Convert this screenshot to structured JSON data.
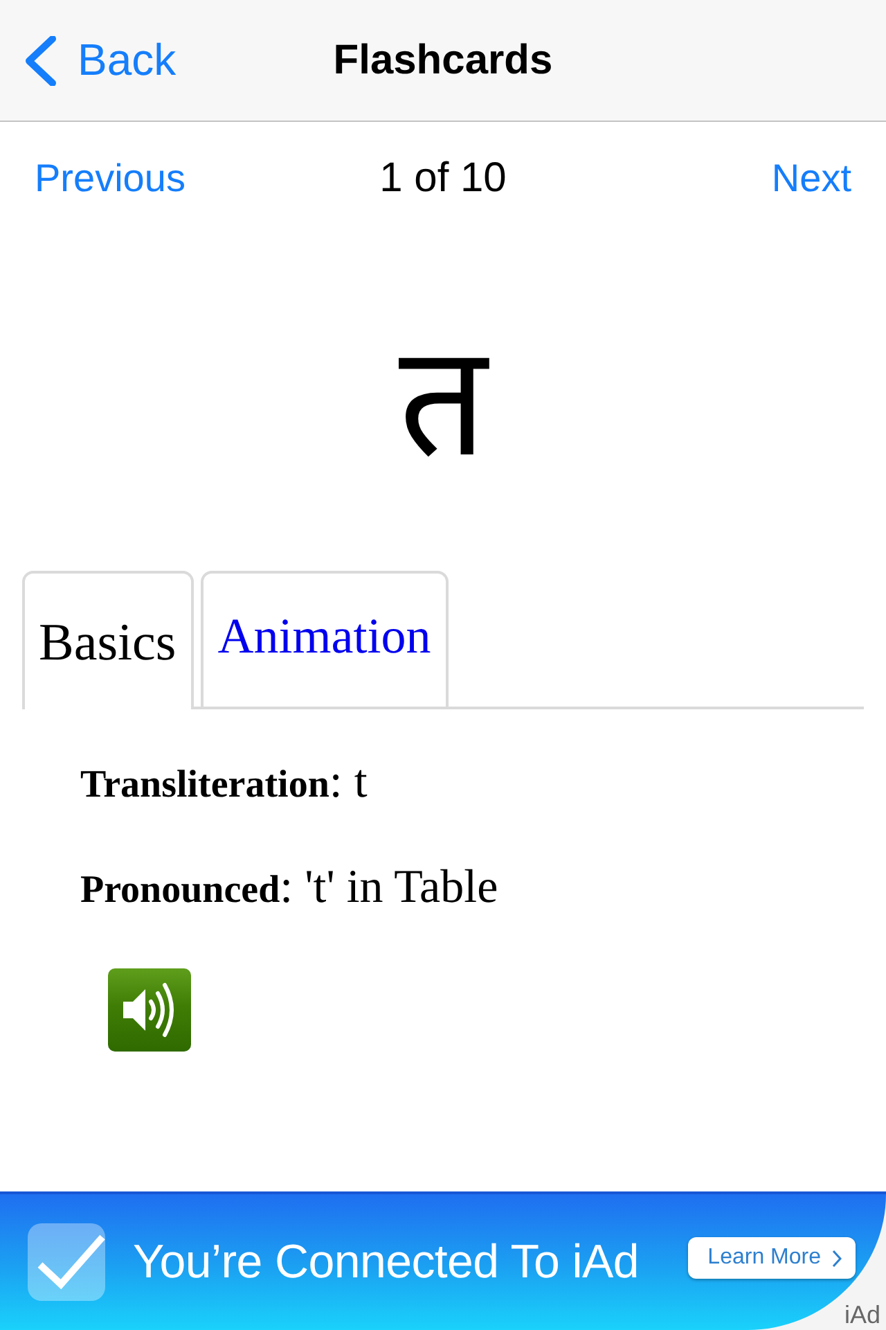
{
  "nav": {
    "back": "Back",
    "title": "Flashcards"
  },
  "pager": {
    "previous": "Previous",
    "position": "1 of 10",
    "next": "Next"
  },
  "card": {
    "character": "त"
  },
  "tabs": [
    {
      "label": "Basics",
      "selected": true
    },
    {
      "label": "Animation",
      "selected": false
    }
  ],
  "details": [
    {
      "text": "**Transliteration**: t"
    },
    {
      "text": "**Pronounced**: 't' in Table"
    }
  ],
  "ad": {
    "headline": "You’re Connected To iAd",
    "button": "Learn More",
    "brand": "iAd"
  }
}
